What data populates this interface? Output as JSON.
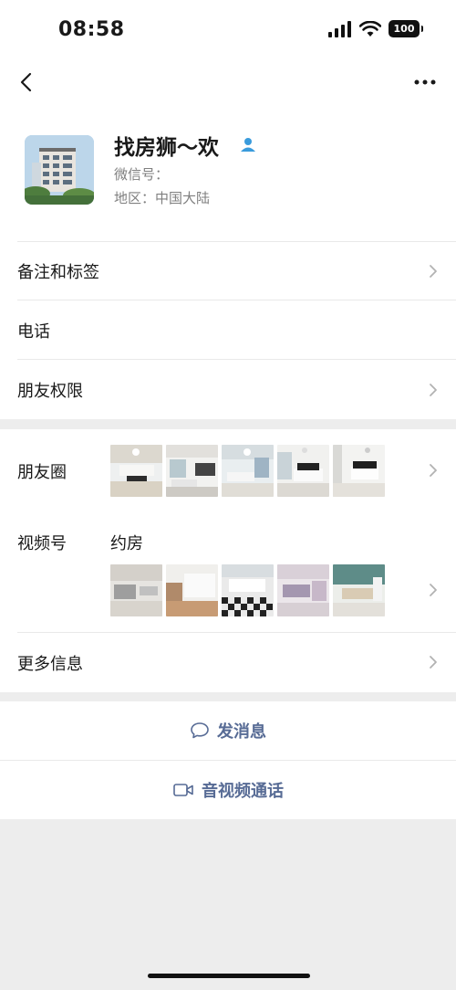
{
  "status_bar": {
    "time": "08:58",
    "battery": "100"
  },
  "profile": {
    "name": "找房狮～欢",
    "wechat_id_label": "微信号：",
    "region": "地区：中国大陆"
  },
  "section1": [
    {
      "label": "备注和标签",
      "chevron": true
    },
    {
      "label": "电话",
      "chevron": false
    },
    {
      "label": "朋友权限",
      "chevron": true
    }
  ],
  "section2": {
    "moments_label": "朋友圈",
    "channels_label": "视频号",
    "channel_name": "约房",
    "more_info_label": "更多信息"
  },
  "actions": {
    "message": "发消息",
    "call": "音视频通话"
  },
  "colors": {
    "link": "#576b95",
    "background": "#ededed",
    "badge": "#3a9bdc"
  }
}
